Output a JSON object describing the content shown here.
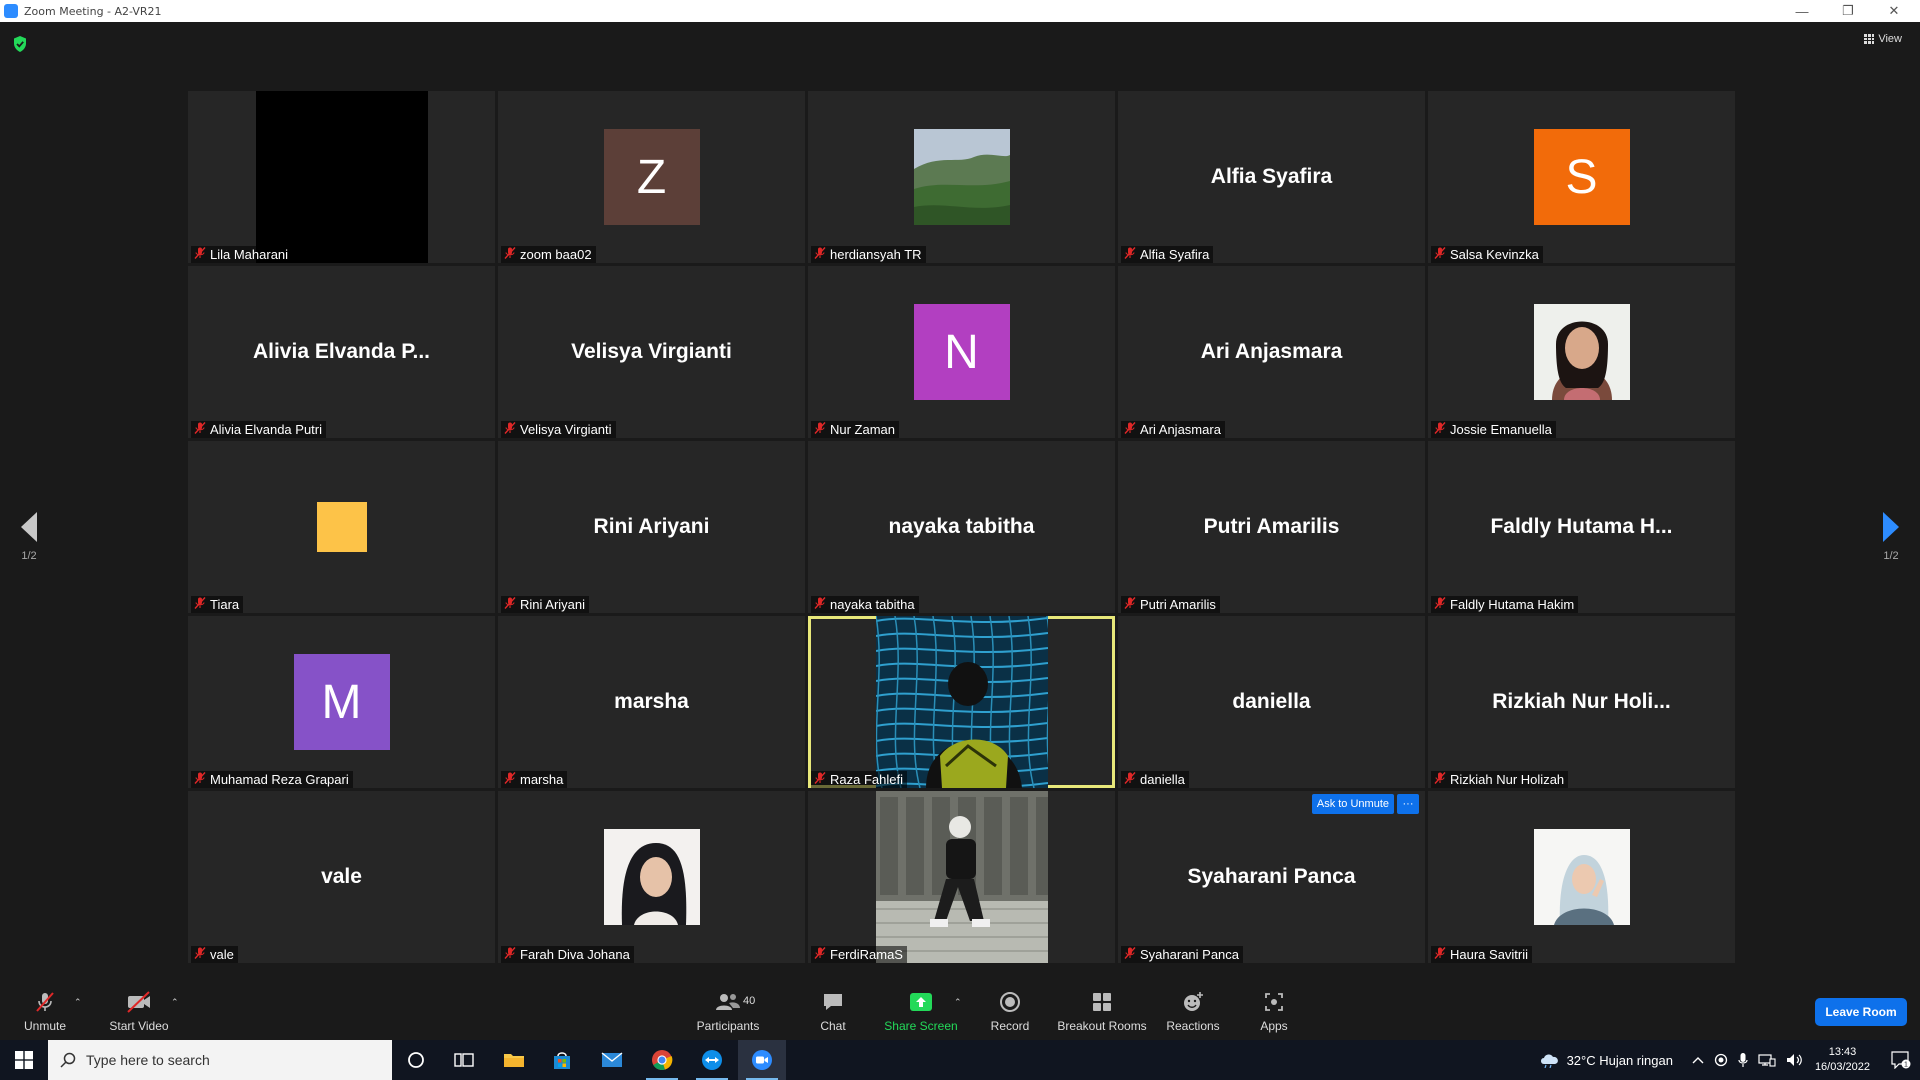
{
  "window": {
    "title": "Zoom Meeting - A2-VR21"
  },
  "header": {
    "view_label": "View"
  },
  "pagination": {
    "left": "1/2",
    "right": "1/2"
  },
  "colors": {
    "accent": "#2d8cff",
    "leave": "#0e71eb",
    "active_speaker": "#e8e87a",
    "muted": "#e02828"
  },
  "participants": [
    {
      "name": "Lila Maharani",
      "display": "video",
      "video": "dark"
    },
    {
      "name": "zoom baa02",
      "display": "avatar",
      "initial": "Z",
      "color": "#5c3f38"
    },
    {
      "name": "herdiansyah TR",
      "display": "photo",
      "photo": "landscape"
    },
    {
      "name": "Alfia Syafira",
      "display": "text",
      "big": "Alfia Syafira"
    },
    {
      "name": "Salsa Kevinzka",
      "display": "avatar",
      "initial": "S",
      "color": "#f26b0a"
    },
    {
      "name": "Alivia Elvanda Putri",
      "display": "text",
      "big": "Alivia Elvanda P..."
    },
    {
      "name": "Velisya Virgianti",
      "display": "text",
      "big": "Velisya Virgianti"
    },
    {
      "name": "Nur Zaman",
      "display": "avatar",
      "initial": "N",
      "color": "#b23fc1"
    },
    {
      "name": "Ari Anjasmara",
      "display": "text",
      "big": "Ari Anjasmara"
    },
    {
      "name": "Jossie Emanuella",
      "display": "photo",
      "photo": "portrait"
    },
    {
      "name": "Tiara",
      "display": "avatar",
      "initial": "",
      "color": "#fdc348",
      "small": true
    },
    {
      "name": "Rini Ariyani",
      "display": "text",
      "big": "Rini Ariyani"
    },
    {
      "name": "nayaka tabitha",
      "display": "text",
      "big": "nayaka tabitha"
    },
    {
      "name": "Putri Amarilis",
      "display": "text",
      "big": "Putri Amarilis"
    },
    {
      "name": "Faldly Hutama Hakim",
      "display": "text",
      "big": "Faldly Hutama H..."
    },
    {
      "name": "Muhamad Reza Grapari",
      "display": "avatar",
      "initial": "M",
      "color": "#8652c8"
    },
    {
      "name": "marsha",
      "display": "text",
      "big": "marsha"
    },
    {
      "name": "Raza Fahlefi",
      "display": "video",
      "video": "pool",
      "active": true
    },
    {
      "name": "daniella",
      "display": "text",
      "big": "daniella"
    },
    {
      "name": "Rizkiah Nur Holizah",
      "display": "text",
      "big": "Rizkiah Nur Holi..."
    },
    {
      "name": "vale",
      "display": "text",
      "big": "vale"
    },
    {
      "name": "Farah Diva Johana",
      "display": "photo",
      "photo": "hijab"
    },
    {
      "name": "FerdiRamaS",
      "display": "video",
      "video": "street"
    },
    {
      "name": "Syaharani Panca",
      "display": "text",
      "big": "Syaharani Panca",
      "ask_unmute": true
    },
    {
      "name": "Haura Savitrii",
      "display": "photo",
      "photo": "hijab-light"
    }
  ],
  "hover_actions": {
    "ask_unmute": "Ask to Unmute",
    "more": "···"
  },
  "toolbar": {
    "unmute": "Unmute",
    "start_video": "Start Video",
    "participants": "Participants",
    "participants_count": "40",
    "chat": "Chat",
    "share_screen": "Share Screen",
    "record": "Record",
    "breakout_rooms": "Breakout Rooms",
    "reactions": "Reactions",
    "apps": "Apps",
    "leave": "Leave Room"
  },
  "taskbar": {
    "search_placeholder": "Type here to search",
    "weather": "32°C  Hujan ringan",
    "time": "13:43",
    "date": "16/03/2022",
    "notification_count": "1"
  }
}
